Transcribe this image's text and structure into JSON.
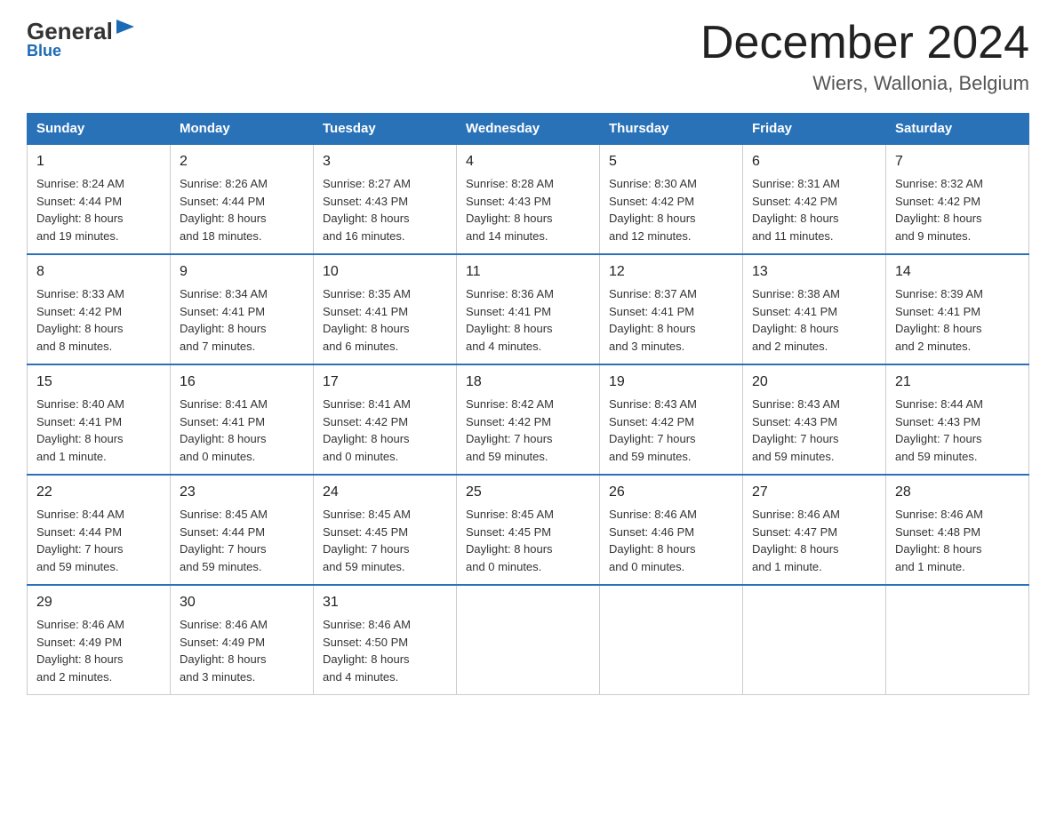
{
  "header": {
    "logo_general": "General",
    "logo_blue": "Blue",
    "month_title": "December 2024",
    "location": "Wiers, Wallonia, Belgium"
  },
  "columns": [
    "Sunday",
    "Monday",
    "Tuesday",
    "Wednesday",
    "Thursday",
    "Friday",
    "Saturday"
  ],
  "weeks": [
    [
      {
        "day": "1",
        "info": "Sunrise: 8:24 AM\nSunset: 4:44 PM\nDaylight: 8 hours\nand 19 minutes."
      },
      {
        "day": "2",
        "info": "Sunrise: 8:26 AM\nSunset: 4:44 PM\nDaylight: 8 hours\nand 18 minutes."
      },
      {
        "day": "3",
        "info": "Sunrise: 8:27 AM\nSunset: 4:43 PM\nDaylight: 8 hours\nand 16 minutes."
      },
      {
        "day": "4",
        "info": "Sunrise: 8:28 AM\nSunset: 4:43 PM\nDaylight: 8 hours\nand 14 minutes."
      },
      {
        "day": "5",
        "info": "Sunrise: 8:30 AM\nSunset: 4:42 PM\nDaylight: 8 hours\nand 12 minutes."
      },
      {
        "day": "6",
        "info": "Sunrise: 8:31 AM\nSunset: 4:42 PM\nDaylight: 8 hours\nand 11 minutes."
      },
      {
        "day": "7",
        "info": "Sunrise: 8:32 AM\nSunset: 4:42 PM\nDaylight: 8 hours\nand 9 minutes."
      }
    ],
    [
      {
        "day": "8",
        "info": "Sunrise: 8:33 AM\nSunset: 4:42 PM\nDaylight: 8 hours\nand 8 minutes."
      },
      {
        "day": "9",
        "info": "Sunrise: 8:34 AM\nSunset: 4:41 PM\nDaylight: 8 hours\nand 7 minutes."
      },
      {
        "day": "10",
        "info": "Sunrise: 8:35 AM\nSunset: 4:41 PM\nDaylight: 8 hours\nand 6 minutes."
      },
      {
        "day": "11",
        "info": "Sunrise: 8:36 AM\nSunset: 4:41 PM\nDaylight: 8 hours\nand 4 minutes."
      },
      {
        "day": "12",
        "info": "Sunrise: 8:37 AM\nSunset: 4:41 PM\nDaylight: 8 hours\nand 3 minutes."
      },
      {
        "day": "13",
        "info": "Sunrise: 8:38 AM\nSunset: 4:41 PM\nDaylight: 8 hours\nand 2 minutes."
      },
      {
        "day": "14",
        "info": "Sunrise: 8:39 AM\nSunset: 4:41 PM\nDaylight: 8 hours\nand 2 minutes."
      }
    ],
    [
      {
        "day": "15",
        "info": "Sunrise: 8:40 AM\nSunset: 4:41 PM\nDaylight: 8 hours\nand 1 minute."
      },
      {
        "day": "16",
        "info": "Sunrise: 8:41 AM\nSunset: 4:41 PM\nDaylight: 8 hours\nand 0 minutes."
      },
      {
        "day": "17",
        "info": "Sunrise: 8:41 AM\nSunset: 4:42 PM\nDaylight: 8 hours\nand 0 minutes."
      },
      {
        "day": "18",
        "info": "Sunrise: 8:42 AM\nSunset: 4:42 PM\nDaylight: 7 hours\nand 59 minutes."
      },
      {
        "day": "19",
        "info": "Sunrise: 8:43 AM\nSunset: 4:42 PM\nDaylight: 7 hours\nand 59 minutes."
      },
      {
        "day": "20",
        "info": "Sunrise: 8:43 AM\nSunset: 4:43 PM\nDaylight: 7 hours\nand 59 minutes."
      },
      {
        "day": "21",
        "info": "Sunrise: 8:44 AM\nSunset: 4:43 PM\nDaylight: 7 hours\nand 59 minutes."
      }
    ],
    [
      {
        "day": "22",
        "info": "Sunrise: 8:44 AM\nSunset: 4:44 PM\nDaylight: 7 hours\nand 59 minutes."
      },
      {
        "day": "23",
        "info": "Sunrise: 8:45 AM\nSunset: 4:44 PM\nDaylight: 7 hours\nand 59 minutes."
      },
      {
        "day": "24",
        "info": "Sunrise: 8:45 AM\nSunset: 4:45 PM\nDaylight: 7 hours\nand 59 minutes."
      },
      {
        "day": "25",
        "info": "Sunrise: 8:45 AM\nSunset: 4:45 PM\nDaylight: 8 hours\nand 0 minutes."
      },
      {
        "day": "26",
        "info": "Sunrise: 8:46 AM\nSunset: 4:46 PM\nDaylight: 8 hours\nand 0 minutes."
      },
      {
        "day": "27",
        "info": "Sunrise: 8:46 AM\nSunset: 4:47 PM\nDaylight: 8 hours\nand 1 minute."
      },
      {
        "day": "28",
        "info": "Sunrise: 8:46 AM\nSunset: 4:48 PM\nDaylight: 8 hours\nand 1 minute."
      }
    ],
    [
      {
        "day": "29",
        "info": "Sunrise: 8:46 AM\nSunset: 4:49 PM\nDaylight: 8 hours\nand 2 minutes."
      },
      {
        "day": "30",
        "info": "Sunrise: 8:46 AM\nSunset: 4:49 PM\nDaylight: 8 hours\nand 3 minutes."
      },
      {
        "day": "31",
        "info": "Sunrise: 8:46 AM\nSunset: 4:50 PM\nDaylight: 8 hours\nand 4 minutes."
      },
      {
        "day": "",
        "info": ""
      },
      {
        "day": "",
        "info": ""
      },
      {
        "day": "",
        "info": ""
      },
      {
        "day": "",
        "info": ""
      }
    ]
  ]
}
